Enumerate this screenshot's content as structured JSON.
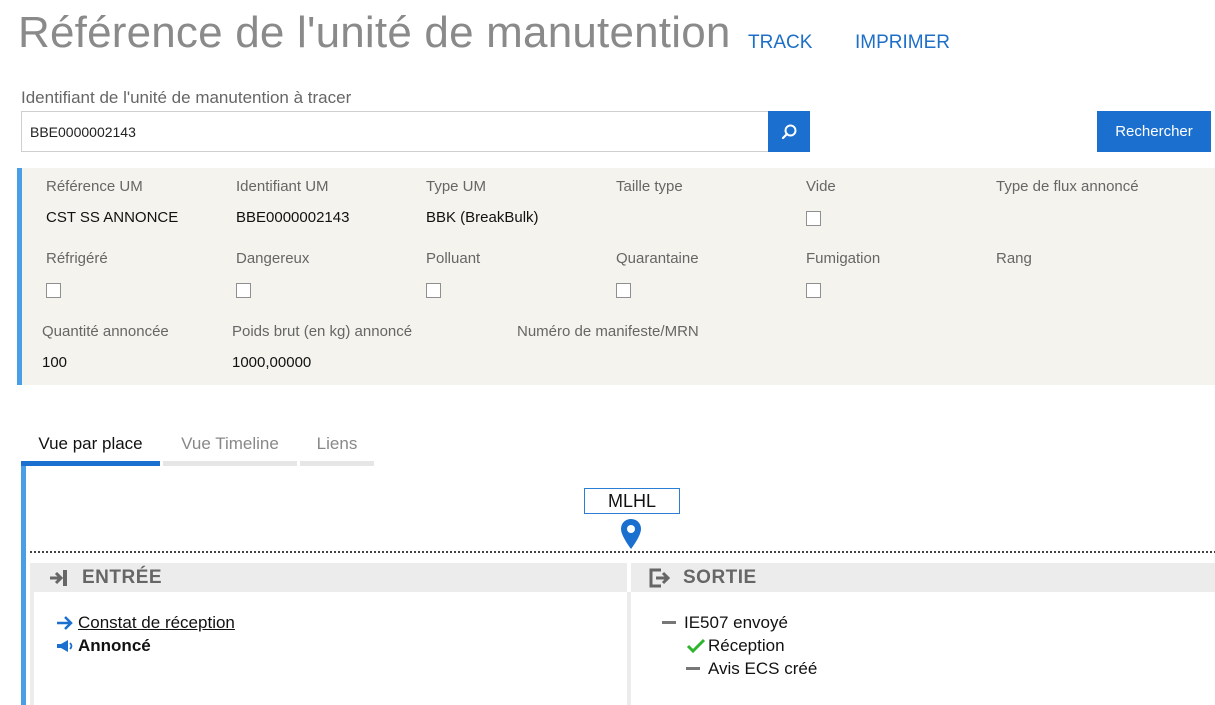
{
  "header": {
    "title": "Référence de l'unité de manutention",
    "track_label": "TRACK",
    "print_label": "IMPRIMER"
  },
  "search": {
    "label": "Identifiant de l'unité de manutention à tracer",
    "value": "BBE0000002143",
    "button_label": "Rechercher"
  },
  "info": {
    "row1": [
      {
        "label": "Référence UM",
        "value": "CST SS ANNONCE"
      },
      {
        "label": "Identifiant UM",
        "value": "BBE0000002143"
      },
      {
        "label": "Type UM",
        "value": "BBK (BreakBulk)"
      },
      {
        "label": "Taille type",
        "value": ""
      },
      {
        "label": "Vide",
        "checked": false
      },
      {
        "label": "Type de flux annoncé",
        "value": ""
      }
    ],
    "row2": [
      {
        "label": "Réfrigéré",
        "checked": false
      },
      {
        "label": "Dangereux",
        "checked": false
      },
      {
        "label": "Polluant",
        "checked": false
      },
      {
        "label": "Quarantaine",
        "checked": false
      },
      {
        "label": "Fumigation",
        "checked": false
      },
      {
        "label": "Rang",
        "value": ""
      }
    ],
    "row3": [
      {
        "label": "Quantité annoncée",
        "value": "100"
      },
      {
        "label": "Poids brut (en kg) annoncé",
        "value": "1000,00000"
      },
      {
        "label": "Numéro de manifeste/MRN",
        "value": ""
      }
    ]
  },
  "tabs": [
    {
      "label": "Vue par place",
      "active": true
    },
    {
      "label": "Vue Timeline",
      "active": false
    },
    {
      "label": "Liens",
      "active": false
    }
  ],
  "place": {
    "label": "MLHL"
  },
  "entree": {
    "title": "ENTRÉE",
    "events": [
      {
        "label": "Constat de réception",
        "icon": "arrow-right-icon"
      },
      {
        "label": "Annoncé",
        "icon": "megaphone-icon"
      }
    ]
  },
  "sortie": {
    "title": "SORTIE",
    "events": [
      {
        "label": "IE507 envoyé",
        "icon": "dash-icon"
      },
      {
        "label": "Réception",
        "icon": "checkmark-icon"
      },
      {
        "label": "Avis ECS créé",
        "icon": "dash-icon"
      }
    ]
  },
  "colors": {
    "accent": "#1a6fcf",
    "panel_bg": "#f5f3ed",
    "success": "#2db52d"
  }
}
